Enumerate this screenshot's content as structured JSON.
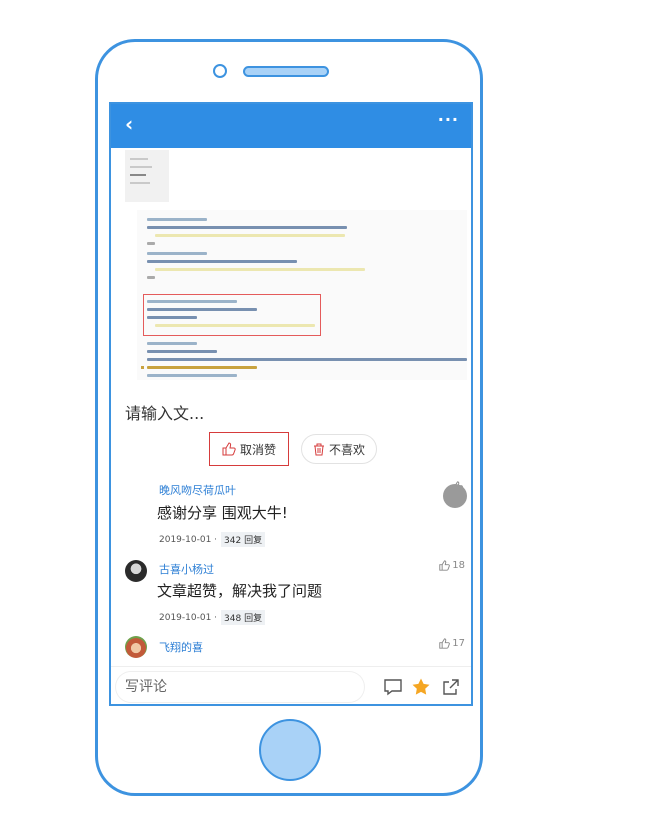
{
  "colors": {
    "brand": "#2f8de4",
    "phone_outline": "#3d93e0",
    "name_link": "#2d7fd5",
    "alert": "#d63b3b",
    "star": "#f5a623"
  },
  "header": {
    "back_icon": "chevron-left-icon",
    "more_label": "···"
  },
  "editor": {
    "placeholder": "请输入文..."
  },
  "actions": {
    "cancel_like_label": "取消赞",
    "dislike_label": "不喜欢"
  },
  "comments": [
    {
      "name": "晚风吻尽荷瓜叶",
      "text": "感谢分享 围观大牛!",
      "date": "2019-10-01 ·",
      "reply": "342 回复",
      "likes": "",
      "avatar": "none"
    },
    {
      "name": "古喜小杨过",
      "text": "文章超赞，解决我了问题",
      "date": "2019-10-01 ·",
      "reply": "348 回复",
      "likes": "18",
      "avatar": "dark"
    },
    {
      "name": "飞翔的喜",
      "text": "",
      "date": "",
      "reply": "",
      "likes": "17",
      "avatar": "cartoon"
    }
  ],
  "bottombar": {
    "comment_placeholder": "写评论",
    "icons": [
      "comment-icon",
      "star-icon",
      "share-icon"
    ]
  }
}
